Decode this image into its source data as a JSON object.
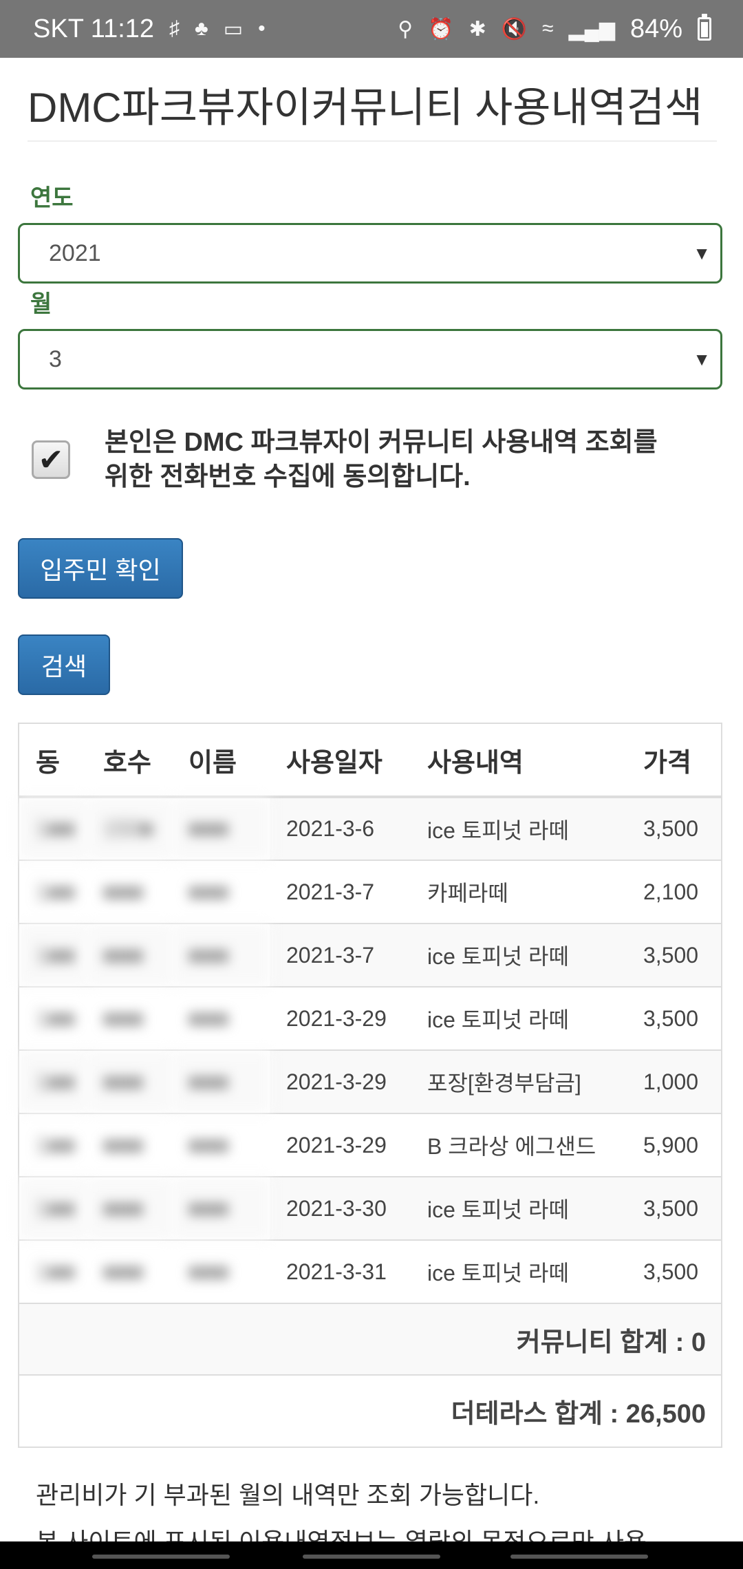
{
  "status_bar": {
    "carrier_time": "SKT 11:12",
    "left_icons": [
      "bixby-icon",
      "cherry-icon",
      "card-icon",
      "dot-icon"
    ],
    "right_icons": [
      "key-icon",
      "alarm-icon",
      "bluetooth-icon",
      "mute-icon",
      "wifi-icon",
      "signal-icon"
    ],
    "battery": "84%"
  },
  "page": {
    "title": "DMC파크뷰자이커뮤니티 사용내역검색"
  },
  "form": {
    "year_label": "연도",
    "year_value": "2021",
    "month_label": "월",
    "month_value": "3",
    "agree_text_line1": "본인은 DMC 파크뷰자이 커뮤니티 사용내역 조회를",
    "agree_text_line2": "위한 전화번호 수집에 동의합니다.",
    "agree_checked": true,
    "resident_button": "입주민 확인",
    "search_button": "검색"
  },
  "table": {
    "headers": [
      "동",
      "호수",
      "이름",
      "사용일자",
      "사용내역",
      "가격"
    ],
    "rows": [
      {
        "dong": "1■■",
        "ho": "150■",
        "name": "■■■",
        "date": "2021-3-6",
        "item": "ice 토피넛 라떼",
        "price": "3,500"
      },
      {
        "dong": "1■■",
        "ho": "■■■",
        "name": "■■■",
        "date": "2021-3-7",
        "item": "카페라떼",
        "price": "2,100"
      },
      {
        "dong": "1■■",
        "ho": "■■■",
        "name": "■■■",
        "date": "2021-3-7",
        "item": "ice 토피넛 라떼",
        "price": "3,500"
      },
      {
        "dong": "1■■",
        "ho": "■■■",
        "name": "■■■",
        "date": "2021-3-29",
        "item": "ice 토피넛 라떼",
        "price": "3,500"
      },
      {
        "dong": "1■■",
        "ho": "■■■",
        "name": "■■■",
        "date": "2021-3-29",
        "item": "포장[환경부담금]",
        "price": "1,000"
      },
      {
        "dong": "1■■",
        "ho": "■■■",
        "name": "■■■",
        "date": "2021-3-29",
        "item": "B 크라상 에그샌드",
        "price": "5,900"
      },
      {
        "dong": "1■■",
        "ho": "■■■",
        "name": "■■■",
        "date": "2021-3-30",
        "item": "ice 토피넛 라떼",
        "price": "3,500"
      },
      {
        "dong": "1■■",
        "ho": "■■■",
        "name": "■■■",
        "date": "2021-3-31",
        "item": "ice 토피넛 라떼",
        "price": "3,500"
      }
    ],
    "community_total": "커뮤니티 합계 : 0",
    "terrace_total": "더테라스 합계 : 26,500"
  },
  "notices": {
    "line1": "관리비가 기 부과된 월의 내역만 조회 가능합니다.",
    "line2": "본 사이트에 표시된 이용내역정보는 열람의 목적으로만 사용"
  }
}
